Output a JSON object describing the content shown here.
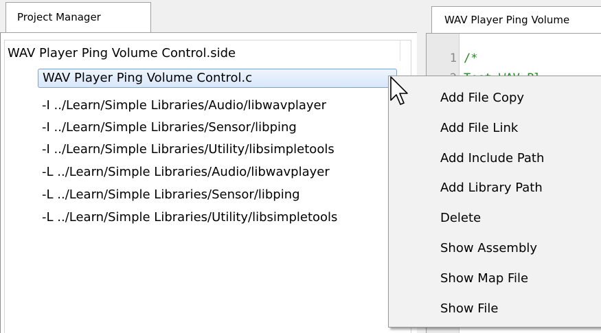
{
  "tabs": {
    "project_manager": "Project Manager",
    "editor": "WAV Player Ping Volume"
  },
  "tree": {
    "root": "WAV Player Ping Volume Control.side",
    "items": [
      "WAV Player Ping Volume Control.c",
      "-I ../Learn/Simple Libraries/Audio/libwavplayer",
      "-I ../Learn/Simple Libraries/Sensor/libping",
      "-I ../Learn/Simple Libraries/Utility/libsimpletools",
      "-L ../Learn/Simple Libraries/Audio/libwavplayer",
      "-L ../Learn/Simple Libraries/Sensor/libping",
      "-L ../Learn/Simple Libraries/Utility/libsimpletools"
    ]
  },
  "editor": {
    "line_numbers": [
      "1",
      "2"
    ],
    "code_line_1": "/*",
    "code_line_2": "  Test WAV Pl"
  },
  "context_menu": {
    "items": [
      "Add File Copy",
      "Add File Link",
      "Add Include Path",
      "Add Library Path",
      "Delete",
      "Show Assembly",
      "Show Map File",
      "Show File"
    ]
  }
}
